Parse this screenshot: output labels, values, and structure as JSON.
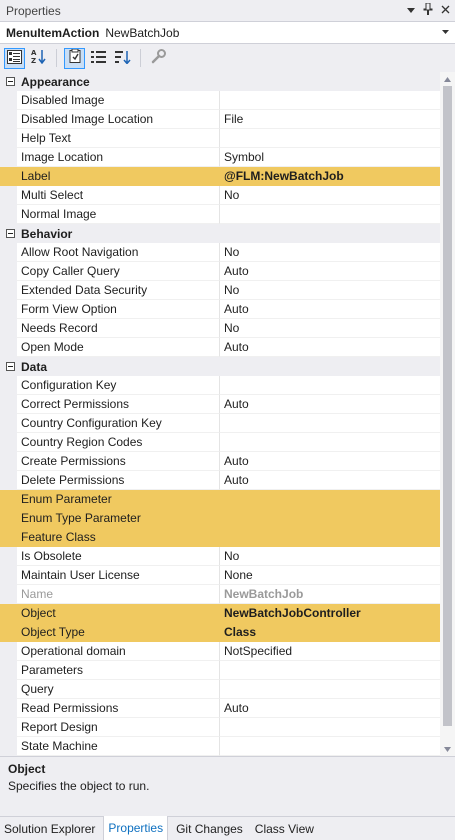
{
  "window": {
    "title": "Properties"
  },
  "object_selector": {
    "type": "MenuItemAction",
    "name": "NewBatchJob"
  },
  "toolbar": {
    "buttons": [
      {
        "icon": "categorized-icon",
        "active": true
      },
      {
        "icon": "alphabetical-icon",
        "active": false
      },
      {
        "icon": "properties-icon",
        "active": true
      },
      {
        "icon": "events-icon",
        "active": false
      },
      {
        "icon": "property-pages-icon",
        "active": false
      },
      {
        "icon": "wrench-icon",
        "active": false
      }
    ]
  },
  "categories": [
    {
      "name": "Appearance",
      "properties": [
        {
          "name": "Disabled Image",
          "value": ""
        },
        {
          "name": "Disabled Image Location",
          "value": "File"
        },
        {
          "name": "Help Text",
          "value": ""
        },
        {
          "name": "Image Location",
          "value": "Symbol"
        },
        {
          "name": "Label",
          "value": "@FLM:NewBatchJob",
          "highlight": true,
          "bold": true
        },
        {
          "name": "Multi Select",
          "value": "No"
        },
        {
          "name": "Normal Image",
          "value": ""
        }
      ]
    },
    {
      "name": "Behavior",
      "properties": [
        {
          "name": "Allow Root Navigation",
          "value": "No"
        },
        {
          "name": "Copy Caller Query",
          "value": "Auto"
        },
        {
          "name": "Extended Data Security",
          "value": "No"
        },
        {
          "name": "Form View Option",
          "value": "Auto"
        },
        {
          "name": "Needs Record",
          "value": "No"
        },
        {
          "name": "Open Mode",
          "value": "Auto"
        }
      ]
    },
    {
      "name": "Data",
      "properties": [
        {
          "name": "Configuration Key",
          "value": ""
        },
        {
          "name": "Correct Permissions",
          "value": "Auto"
        },
        {
          "name": "Country Configuration Key",
          "value": ""
        },
        {
          "name": "Country Region Codes",
          "value": ""
        },
        {
          "name": "Create Permissions",
          "value": "Auto"
        },
        {
          "name": "Delete Permissions",
          "value": "Auto"
        },
        {
          "name": "Enum Parameter",
          "value": "",
          "highlight": true
        },
        {
          "name": "Enum Type Parameter",
          "value": "",
          "highlight": true
        },
        {
          "name": "Feature Class",
          "value": "",
          "highlight": true
        },
        {
          "name": "Is Obsolete",
          "value": "No"
        },
        {
          "name": "Maintain User License",
          "value": "None"
        },
        {
          "name": "Name",
          "value": "NewBatchJob",
          "muted": true,
          "bold": true
        },
        {
          "name": "Object",
          "value": "NewBatchJobController",
          "highlight": true,
          "bold": true
        },
        {
          "name": "Object Type",
          "value": "Class",
          "highlight": true,
          "bold": true
        },
        {
          "name": "Operational domain",
          "value": "NotSpecified"
        },
        {
          "name": "Parameters",
          "value": ""
        },
        {
          "name": "Query",
          "value": ""
        },
        {
          "name": "Read Permissions",
          "value": "Auto"
        },
        {
          "name": "Report Design",
          "value": ""
        },
        {
          "name": "State Machine",
          "value": ""
        }
      ]
    }
  ],
  "description": {
    "title": "Object",
    "text": "Specifies the object to run."
  },
  "tabs": [
    {
      "label": "Solution Explorer",
      "active": false
    },
    {
      "label": "Properties",
      "active": true
    },
    {
      "label": "Git Changes",
      "active": false
    },
    {
      "label": "Class View",
      "active": false
    }
  ],
  "colors": {
    "highlight": "#f0c960",
    "accent": "#0e70c0",
    "chrome": "#eeeef2"
  }
}
